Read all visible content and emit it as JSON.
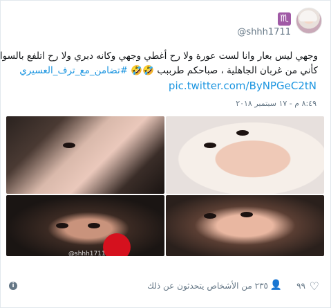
{
  "author": {
    "handle": "@shhh1711",
    "badge_symbol": "♏",
    "badge_color": "#a05aa6"
  },
  "tweet": {
    "line1": "وجهي ليس بعار وانا لست عورة ولا رح أغطي وجهي وكانه دبري ولا رح اتلفع بالسواد",
    "line2_text": "كأني من غربان الجاهلية ، صباحكم طرببب 🤣🤣",
    "hashtag": "#تضامن_مع_ترف_العسيري",
    "link": "pic.twitter.com/ByNPGeC2tN",
    "timestamp": "٨:٤٩ م - ١٧ سبتمبر ٢٠١٨"
  },
  "media": {
    "caption": "@shhh1711"
  },
  "footer": {
    "likes": "٩٩",
    "talking": "٢٣٥ من الأشخاص يتحدثون عن ذلك",
    "info_icon": "i"
  },
  "colors": {
    "link": "#1b95e0",
    "meta": "#657786"
  }
}
